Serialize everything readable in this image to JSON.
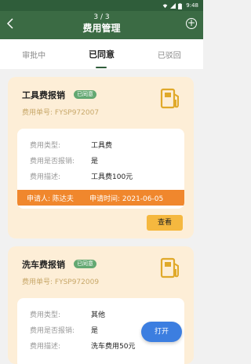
{
  "status_bar": {
    "time": "9:48"
  },
  "header": {
    "page_indicator": "3 / 3",
    "title": "费用管理"
  },
  "tabs": [
    {
      "label": "审批中",
      "active": false
    },
    {
      "label": "已同意",
      "active": true
    },
    {
      "label": "已驳回",
      "active": false
    }
  ],
  "cards": [
    {
      "name": "工具费报销",
      "badge": "已同意",
      "number": "费用单号: FYSP972007",
      "rows": [
        {
          "label": "费用类型:",
          "value": "工具费"
        },
        {
          "label": "费用是否报销:",
          "value": "是"
        },
        {
          "label": "费用描述:",
          "value": "工具费100元"
        }
      ],
      "applicant": "申请人: 陈达夫",
      "apply_time": "申请时间: 2021-06-05",
      "view_label": "查看"
    },
    {
      "name": "洗车费报销",
      "badge": "已同意",
      "number": "费用单号: FYSP972009",
      "rows": [
        {
          "label": "费用类型:",
          "value": "其他"
        },
        {
          "label": "费用是否报销:",
          "value": "是"
        },
        {
          "label": "费用描述:",
          "value": "洗车费用50元"
        }
      ]
    }
  ],
  "open_button": "打开",
  "colors": {
    "header": "#3b6b44",
    "card_bg": "#fdeed7",
    "badge": "#63a872",
    "applicant_bar": "#f0872d",
    "view_button": "#f5b83f",
    "open_button": "#3c7ee0"
  },
  "icons": {
    "pump": "fuel-pump-icon"
  }
}
